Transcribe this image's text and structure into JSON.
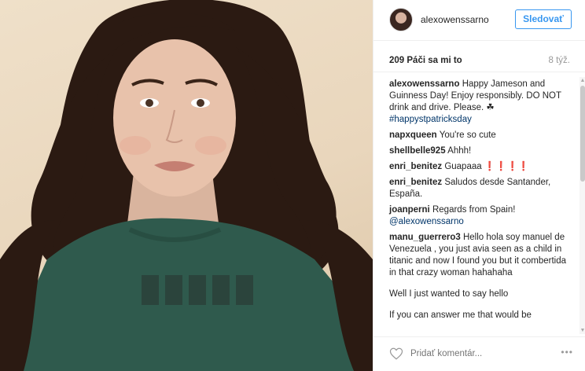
{
  "header": {
    "username": "alexowenssarno",
    "follow_label": "Sledovať"
  },
  "stats": {
    "likes_count": "209",
    "likes_label": "Páči sa mi to",
    "age": "8 týž."
  },
  "comments": [
    {
      "author": "alexowenssarno",
      "text": "Happy Jameson and Guinness Day! Enjoy responsibly. DO NOT drink and drive. Please. ☘",
      "hashtag": "#happystpatricksday"
    },
    {
      "author": "napxqueen",
      "text": "You're so cute"
    },
    {
      "author": "shellbelle925",
      "text": "Ahhh!"
    },
    {
      "author": "enri_benitez",
      "text": "Guapaaa ❗❗❗❗"
    },
    {
      "author": "enri_benitez",
      "text": "Saludos desde Santander, España."
    },
    {
      "author": "joanperni",
      "text": "Regards from Spain!",
      "mention": "@alexowenssarno"
    },
    {
      "author": "manu_guerrero3",
      "text": "Hello hola soy manuel de Venezuela , you just avia seen as a child in titanic and now I found you but it combertida in that crazy woman hahahaha"
    }
  ],
  "extra_lines": [
    "Well I just wanted to say hello",
    "If you can answer me that would be"
  ],
  "footer": {
    "comment_placeholder": "Pridať komentár...",
    "more_label": "•••"
  },
  "icons": {
    "like": "heart-icon",
    "more": "more-options-icon",
    "shamrock": "shamrock-emoji"
  },
  "colors": {
    "accent": "#3897f0",
    "link": "#003569",
    "muted": "#999999",
    "text": "#262626"
  }
}
